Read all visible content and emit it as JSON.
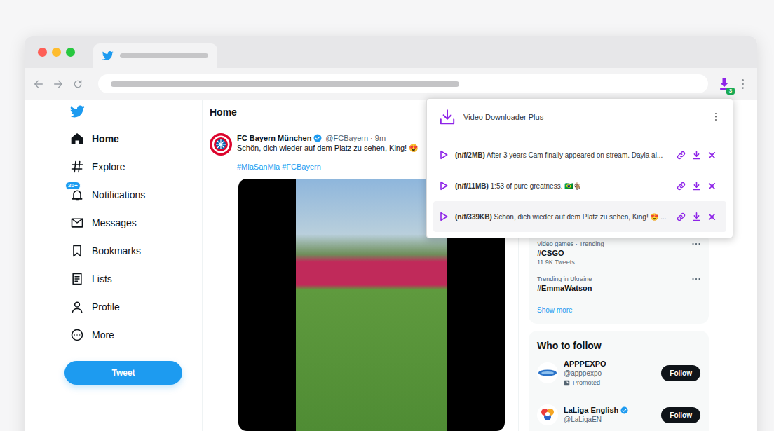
{
  "browser": {
    "extension_badge": "3"
  },
  "sidebar": {
    "items": [
      {
        "label": "Home",
        "selected": true
      },
      {
        "label": "Explore",
        "selected": false
      },
      {
        "label": "Notifications",
        "selected": false,
        "badge": "20+"
      },
      {
        "label": "Messages",
        "selected": false
      },
      {
        "label": "Bookmarks",
        "selected": false
      },
      {
        "label": "Lists",
        "selected": false
      },
      {
        "label": "Profile",
        "selected": false
      },
      {
        "label": "More",
        "selected": false
      }
    ],
    "tweet_button": "Tweet"
  },
  "timeline": {
    "title": "Home",
    "tweet": {
      "author": "FC Bayern München",
      "verified": true,
      "meta": "@FCBayern · 9m",
      "text": "Schön, dich wieder auf dem Platz zu sehen, King! 😍",
      "hashtags": "#MiaSanMia #FCBayern"
    }
  },
  "trends": {
    "items": [
      {
        "category": "Video games · Trending",
        "name": "#CSGO",
        "count": "11.9K Tweets"
      },
      {
        "category": "Trending in Ukraine",
        "name": "#EmmaWatson"
      }
    ],
    "show_more": "Show more"
  },
  "who_to_follow": {
    "title": "Who to follow",
    "items": [
      {
        "name": "APPPEXPO",
        "verified": false,
        "handle": "@apppexpo",
        "promoted": "Promoted",
        "button": "Follow"
      },
      {
        "name": "LaLiga English",
        "verified": true,
        "handle": "@LaLigaEN",
        "button": "Follow"
      }
    ]
  },
  "popup": {
    "title": "Video Downloader Plus",
    "items": [
      {
        "size": "(n/f/2MB)",
        "title": "After 3 years Cam finally appeared on stream. Dayla al...",
        "selected": false
      },
      {
        "size": "(n/f/11MB)",
        "title": "1:53 of pure greatness. 🇧🇷🐐",
        "selected": false
      },
      {
        "size": "(n/f/339KB)",
        "title": "Schön, dich wieder auf dem Platz zu sehen, King! 😍 ...",
        "selected": true
      }
    ]
  }
}
